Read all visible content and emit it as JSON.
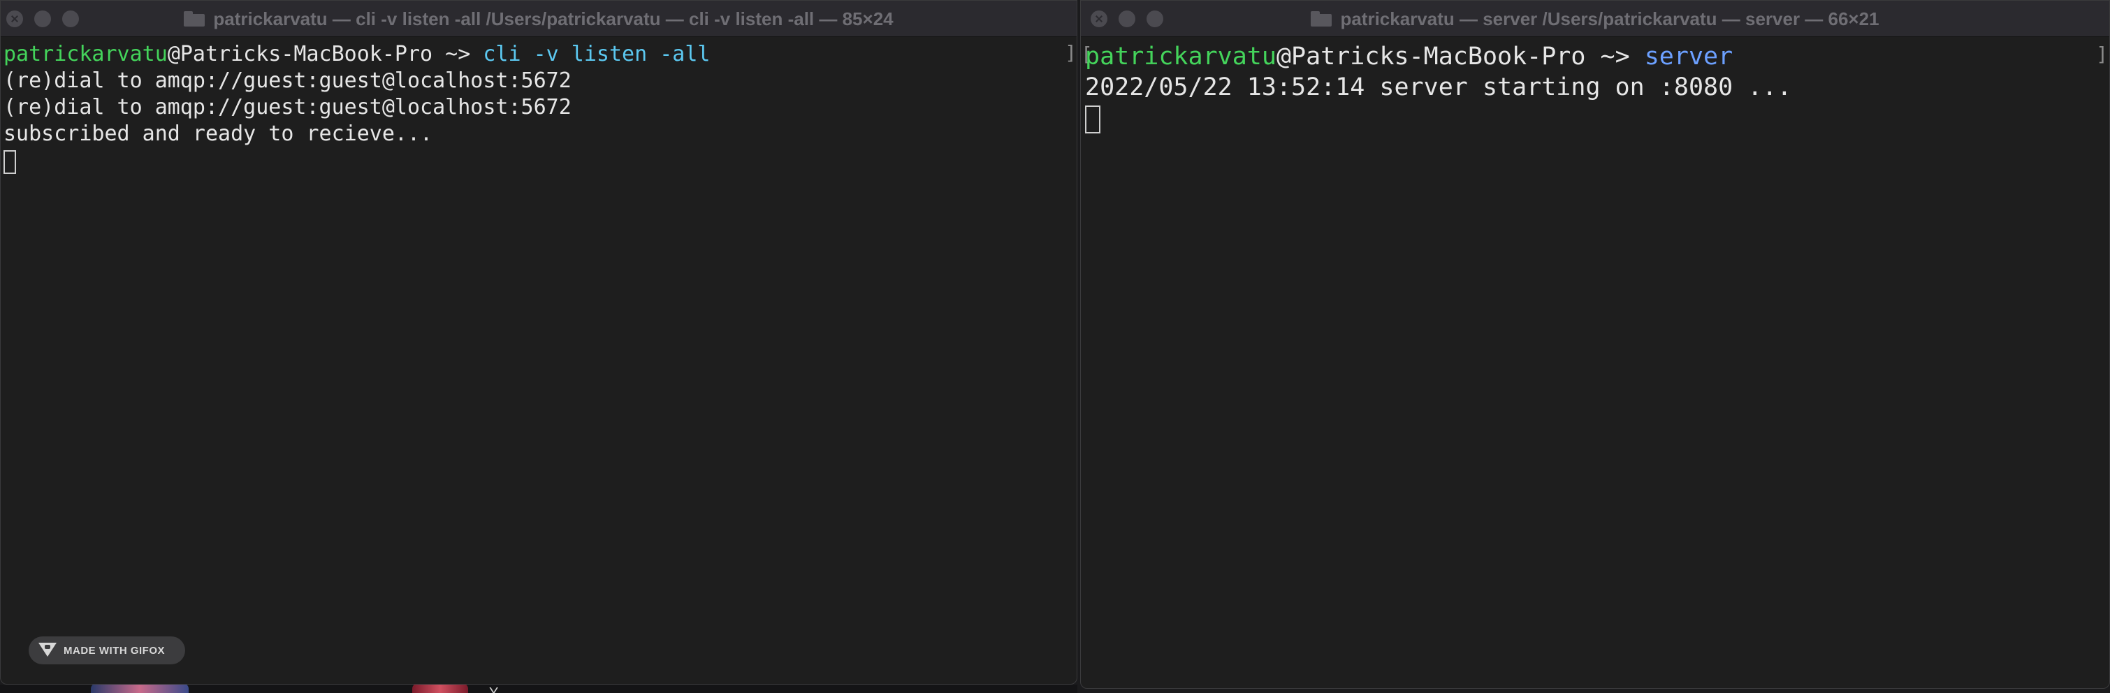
{
  "left_window": {
    "title": "patrickarvatu — cli -v listen -all /Users/patrickarvatu — cli -v listen -all — 85×24",
    "prompt_user": "patrickarvatu",
    "prompt_host": "@Patricks-MacBook-Pro ~> ",
    "command": "cli -v listen -all",
    "output": [
      "(re)dial to amqp://guest:guest@localhost:5672",
      "(re)dial to amqp://guest:guest@localhost:5672",
      "subscribed and ready to recieve..."
    ],
    "edge_mark": "]"
  },
  "right_window": {
    "title": "patrickarvatu — server /Users/patrickarvatu — server — 66×21",
    "prompt_user": "patrickarvatu",
    "prompt_host": "@Patricks-MacBook-Pro ~> ",
    "command": "server",
    "output": [
      "2022/05/22 13:52:14 server starting on :8080 ..."
    ],
    "edge_mark_left": "[",
    "edge_mark_right": "]"
  },
  "badge": {
    "label": "MADE WITH GIFOX",
    "icon": "fox-icon"
  },
  "colors": {
    "terminal_bg": "#1e1e1e",
    "titlebar_bg": "#2b2a2f",
    "user_green": "#44d45b",
    "cmd_cyan": "#5cc8f0",
    "cmd_blue": "#6ca0ff",
    "text": "#e6e6e6"
  }
}
